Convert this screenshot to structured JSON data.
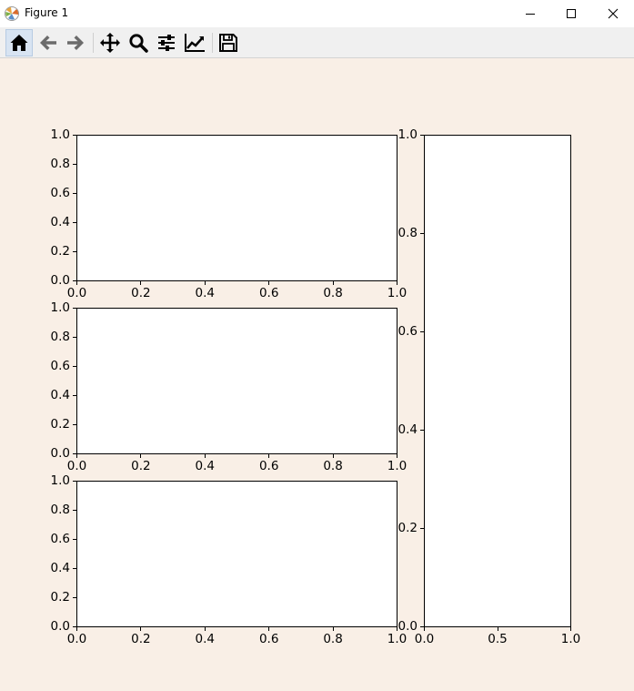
{
  "window": {
    "title": "Figure 1",
    "colors": {
      "figure_background": "#f9efe6",
      "toolbar_background": "#f0f0f0",
      "axes_background": "#ffffff"
    }
  },
  "toolbar": {
    "tools": [
      {
        "name": "home",
        "icon": "home-icon",
        "active": true
      },
      {
        "name": "back",
        "icon": "arrow-left-icon"
      },
      {
        "name": "forward",
        "icon": "arrow-right-icon"
      },
      {
        "name": "pan",
        "icon": "move-icon"
      },
      {
        "name": "zoom",
        "icon": "magnifier-icon"
      },
      {
        "name": "configure-subplots",
        "icon": "sliders-icon"
      },
      {
        "name": "edit-axis",
        "icon": "line-chart-icon"
      },
      {
        "name": "save",
        "icon": "floppy-disk-icon"
      }
    ]
  },
  "chart_data": [
    {
      "type": "line",
      "xlim": [
        0.0,
        1.0
      ],
      "ylim": [
        0.0,
        1.0
      ],
      "xticks": [
        "0.0",
        "0.2",
        "0.4",
        "0.6",
        "0.8",
        "1.0"
      ],
      "yticks": [
        "0.0",
        "0.2",
        "0.4",
        "0.6",
        "0.8",
        "1.0"
      ],
      "series": [],
      "grid": false
    },
    {
      "type": "line",
      "xlim": [
        0.0,
        1.0
      ],
      "ylim": [
        0.0,
        1.0
      ],
      "xticks": [
        "0.0",
        "0.2",
        "0.4",
        "0.6",
        "0.8",
        "1.0"
      ],
      "yticks": [
        "0.0",
        "0.2",
        "0.4",
        "0.6",
        "0.8",
        "1.0"
      ],
      "series": [],
      "grid": false
    },
    {
      "type": "line",
      "xlim": [
        0.0,
        1.0
      ],
      "ylim": [
        0.0,
        1.0
      ],
      "xticks": [
        "0.0",
        "0.2",
        "0.4",
        "0.6",
        "0.8",
        "1.0"
      ],
      "yticks": [
        "0.0",
        "0.2",
        "0.4",
        "0.6",
        "0.8",
        "1.0"
      ],
      "series": [],
      "grid": false
    },
    {
      "type": "line",
      "xlim": [
        0.0,
        1.0
      ],
      "ylim": [
        0.0,
        1.0
      ],
      "xticks": [
        "0.0",
        "0.5",
        "1.0"
      ],
      "yticks": [
        "0.0",
        "0.2",
        "0.4",
        "0.6",
        "0.8",
        "1.0"
      ],
      "series": [],
      "grid": false
    }
  ]
}
